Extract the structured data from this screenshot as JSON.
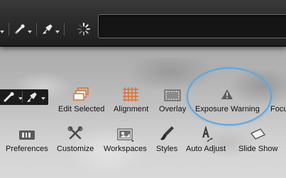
{
  "top_toolbar": {
    "tools": [
      {
        "icon": "dropper-icon"
      },
      {
        "icon": "brush-icon"
      },
      {
        "icon": "stamp-icon"
      }
    ],
    "spinner_icon": "loading-spinner-icon",
    "search": {
      "value": "",
      "placeholder": ""
    }
  },
  "mid_strip": {
    "tools": [
      {
        "icon": "dropper-icon"
      },
      {
        "icon": "stamp-icon"
      }
    ]
  },
  "row1": [
    {
      "label": "Edit Selected",
      "icon": "edit-selected-icon"
    },
    {
      "label": "Alignment",
      "icon": "alignment-grid-icon"
    },
    {
      "label": "Overlay",
      "icon": "overlay-icon"
    },
    {
      "label": "Exposure Warning",
      "icon": "warning-triangle-icon"
    },
    {
      "label": "Focu",
      "icon": "focus-icon"
    }
  ],
  "row2": [
    {
      "label": "Preferences",
      "icon": "preferences-icon"
    },
    {
      "label": "Customize",
      "icon": "tools-icon"
    },
    {
      "label": "Workspaces",
      "icon": "workspaces-icon"
    },
    {
      "label": "Styles",
      "icon": "brush-icon"
    },
    {
      "label": "Auto Adjust",
      "icon": "auto-adjust-icon"
    },
    {
      "label": "Slide Show",
      "icon": "slideshow-icon"
    }
  ],
  "colors": {
    "accent_orange": "#e0702a",
    "highlight_ring": "#5aa8e0",
    "toolbar_dark": "#2b2b2b"
  }
}
